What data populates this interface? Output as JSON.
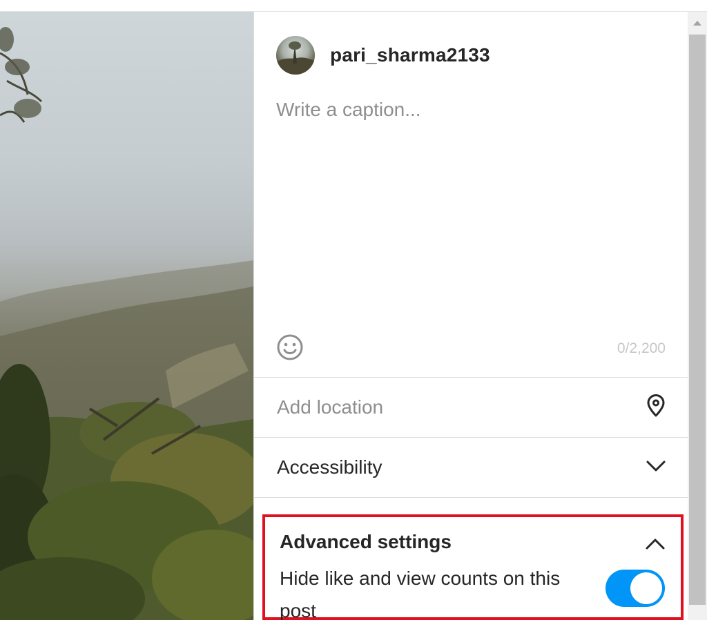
{
  "post": {
    "username": "pari_sharma2133",
    "caption_placeholder": "Write a caption...",
    "caption_counter": "0/2,200"
  },
  "options": {
    "location_placeholder": "Add location",
    "accessibility_label": "Accessibility",
    "advanced_title": "Advanced settings",
    "hide_counts_label": "Hide like and view counts on this post",
    "hide_counts_on": true
  },
  "colors": {
    "toggle_accent": "#0095f6",
    "highlight_border": "#e0101e"
  },
  "icons": {
    "emoji": "smiley-face-icon",
    "location": "location-pin-icon",
    "accessibility": "chevron-down-icon",
    "advanced": "chevron-up-icon",
    "scroll_up": "triangle-up-icon"
  }
}
